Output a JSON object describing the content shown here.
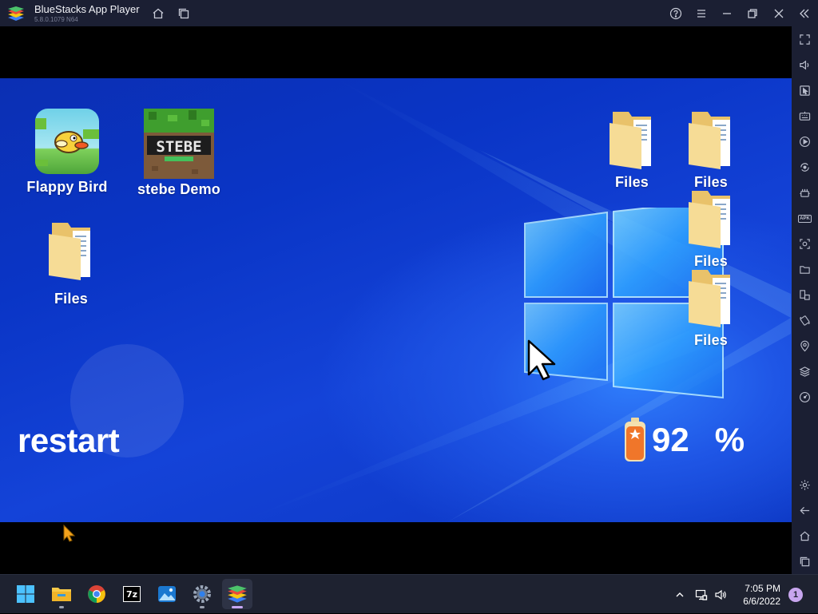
{
  "window": {
    "title": "BlueStacks App Player",
    "version": "5.8.0.1079 N64"
  },
  "titlebar_icons": [
    "home-icon",
    "multi-instance-icon",
    "help-icon",
    "menu-icon",
    "minimize-icon",
    "restore-icon",
    "close-icon",
    "collapse-sidebar-icon"
  ],
  "sidebar": {
    "items": [
      {
        "name": "fullscreen-icon"
      },
      {
        "name": "volume-icon"
      },
      {
        "name": "cursor-lock-icon"
      },
      {
        "name": "keyboard-controls-icon"
      },
      {
        "name": "macro-play-icon"
      },
      {
        "name": "rotate-sync-icon"
      },
      {
        "name": "eco-mode-icon"
      },
      {
        "name": "apk-install-icon",
        "text": "APK"
      },
      {
        "name": "screenshot-icon"
      },
      {
        "name": "media-folder-icon"
      },
      {
        "name": "multi-instance-sync-icon"
      },
      {
        "name": "shake-rotate-icon"
      },
      {
        "name": "location-icon"
      },
      {
        "name": "layers-icon"
      },
      {
        "name": "performance-icon"
      },
      {
        "name": "settings-icon"
      },
      {
        "name": "back-icon"
      },
      {
        "name": "android-home-icon"
      },
      {
        "name": "recent-apps-icon"
      }
    ]
  },
  "desktop": {
    "apps": [
      {
        "label": "Flappy Bird"
      },
      {
        "label": "stebe Demo",
        "tile_text": "STEBE"
      }
    ],
    "folders_left": [
      {
        "label": "Files"
      }
    ],
    "folders_right": [
      {
        "label": "Files"
      },
      {
        "label": "Files"
      },
      {
        "label": "Files"
      },
      {
        "label": "Files"
      }
    ],
    "restart_label": "restart",
    "battery": {
      "value": "92",
      "unit": "%",
      "level": 0.92
    }
  },
  "taskbar": {
    "apps": [
      {
        "name": "start-button",
        "active": false
      },
      {
        "name": "file-explorer",
        "active": false
      },
      {
        "name": "chrome",
        "active": false
      },
      {
        "name": "7zip",
        "active": false,
        "text": "7z"
      },
      {
        "name": "photos",
        "active": false
      },
      {
        "name": "settings",
        "active": false
      },
      {
        "name": "bluestacks",
        "active": true
      }
    ],
    "clock_time": "7:05 PM",
    "clock_date": "6/6/2022",
    "notification_count": "1"
  }
}
